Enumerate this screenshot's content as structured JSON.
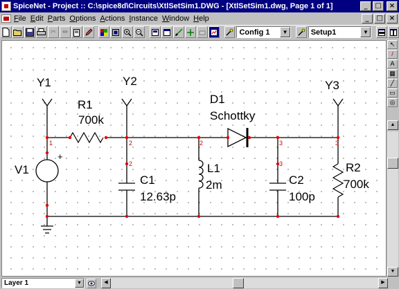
{
  "window": {
    "title": "SpiceNet - Project :: C:\\spice8d\\Circuits\\XtlSetSim1.DWG - [XtlSetSim1.dwg, Page 1 of 1]",
    "buttons": {
      "minimize": "_",
      "maximize": "□",
      "close": "×"
    }
  },
  "menu": {
    "items": [
      "File",
      "Edit",
      "Parts",
      "Options",
      "Actions",
      "Instance",
      "Window",
      "Help"
    ]
  },
  "toolbar": {
    "config_select": "Config 1",
    "setup_select": "Setup1"
  },
  "schematic": {
    "probes": [
      "Y1",
      "Y2",
      "Y3"
    ],
    "parts": [
      {
        "ref": "R1",
        "value": "700k"
      },
      {
        "ref": "V1",
        "value": ""
      },
      {
        "ref": "C1",
        "value": "12.63p"
      },
      {
        "ref": "L1",
        "value": "2m"
      },
      {
        "ref": "D1",
        "value": "Schottky"
      },
      {
        "ref": "C2",
        "value": "100p"
      },
      {
        "ref": "R2",
        "value": "700k"
      }
    ],
    "v1_polarity": "+",
    "nodes": {
      "n1": "1",
      "n2": "2",
      "n3": "3"
    }
  },
  "statusbar": {
    "layer": "Layer 1"
  },
  "colors": {
    "titlebar": "#000080",
    "wire": "#000000",
    "junction": "#e00000",
    "node_label": "#d00000",
    "canvas": "#ffffff",
    "chrome": "#c0c0c0"
  }
}
